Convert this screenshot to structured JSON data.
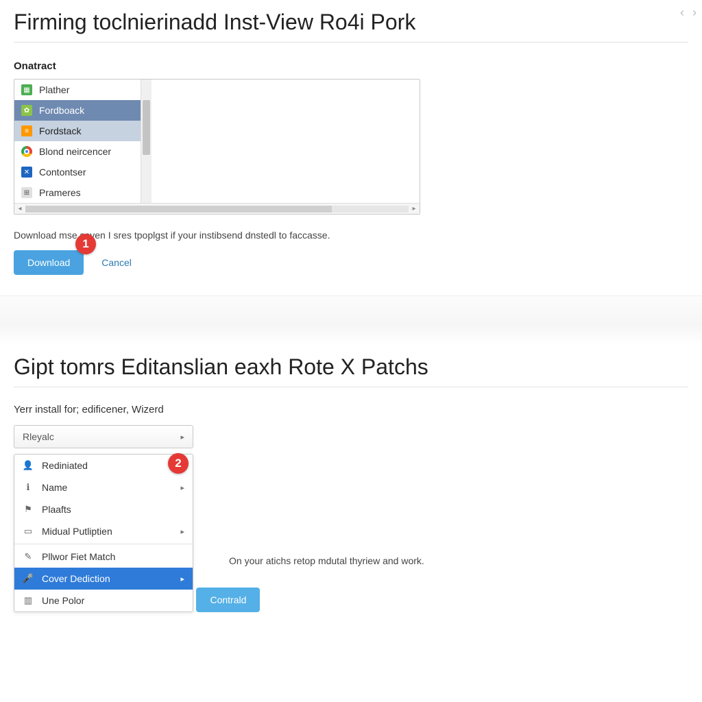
{
  "nav": {
    "back": "‹",
    "fwd": "›"
  },
  "section1": {
    "title": "Firming toclnierinadd Inst-View Ro4i Pork",
    "subheading": "Onatract",
    "listbox": {
      "items": [
        {
          "icon": "green",
          "label": "Plather"
        },
        {
          "icon": "tree",
          "label": "Fordboack",
          "selected": true
        },
        {
          "icon": "brief",
          "label": "Fordstack",
          "selected2": true
        },
        {
          "icon": "chrome",
          "label": "Blond neircencer"
        },
        {
          "icon": "blue",
          "label": "Contontser"
        },
        {
          "icon": "grid",
          "label": "Prameres"
        }
      ]
    },
    "helper": "Download mse seven I sres tpoplgst if your instibsend dnstedl to faccasse.",
    "download_btn": "Download",
    "cancel_btn": "Cancel",
    "badge": "1"
  },
  "section2": {
    "title": "Gipt tomrs Editanslian eaxh Rote X Patchs",
    "sub": "Yerr install for; edificener, Wizerd",
    "dropdown_value": "Rleyalc",
    "menu": [
      {
        "icon": "person",
        "label": "Rediniated"
      },
      {
        "icon": "info",
        "label": "Name",
        "arrow": true
      },
      {
        "icon": "flag",
        "label": "Plaafts"
      },
      {
        "icon": "doc",
        "label": "Midual Putliptien",
        "arrow": true
      },
      {
        "sep": true
      },
      {
        "icon": "wand",
        "label": "Pllwor Fiet Match"
      },
      {
        "icon": "mic",
        "label": "Cover Dediction",
        "arrow": true,
        "highlight": true
      },
      {
        "icon": "bars",
        "label": "Une Polor"
      }
    ],
    "badge": "2",
    "side_note": "On your atichs retop mdutal thyriew and work.",
    "contrald_btn": "Contrald"
  }
}
